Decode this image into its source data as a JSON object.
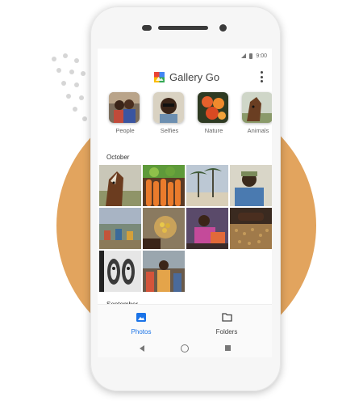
{
  "status_bar": {
    "time": "9:00"
  },
  "app": {
    "title": "Gallery Go",
    "menu_icon": "more-vert-icon"
  },
  "categories": [
    {
      "label": "People",
      "icon": "people-photo"
    },
    {
      "label": "Selfies",
      "icon": "selfie-photo"
    },
    {
      "label": "Nature",
      "icon": "flowers-photo"
    },
    {
      "label": "Animals",
      "icon": "horse-photo"
    }
  ],
  "sections": [
    {
      "title": "October"
    },
    {
      "title": "September"
    }
  ],
  "bottom_nav": {
    "photos": {
      "label": "Photos",
      "icon": "photo-icon",
      "active": true
    },
    "folders": {
      "label": "Folders",
      "icon": "folder-icon",
      "active": false
    }
  },
  "colors": {
    "accent": "#1a73e8",
    "backdrop_circle": "#e2a45e"
  }
}
